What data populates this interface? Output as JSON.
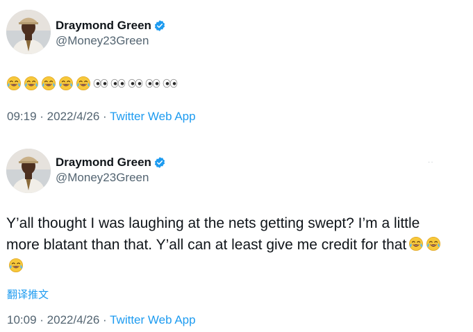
{
  "tweets": [
    {
      "author": {
        "name": "Draymond Green",
        "handle": "@Money23Green",
        "verified": true
      },
      "content": {
        "emojis": [
          "😂",
          "😂",
          "😂",
          "😂",
          "😂",
          "👀",
          "👀",
          "👀",
          "👀",
          "👀"
        ]
      },
      "meta": {
        "time": "09:19",
        "date": "2022/4/26",
        "separator": " · ",
        "app": "Twitter Web App"
      }
    },
    {
      "author": {
        "name": "Draymond Green",
        "handle": "@Money23Green",
        "verified": true
      },
      "content": {
        "text": "Y’all thought I was laughing at the nets getting swept? I’m a little more blatant than that. Y’all can at least give me credit for that",
        "trailing_emojis": [
          "😂",
          "😂",
          "😂"
        ]
      },
      "translate_label": "翻译推文",
      "more_label": "··",
      "meta": {
        "time": "10:09",
        "date": "2022/4/26",
        "separator": " · ",
        "app": "Twitter Web App"
      }
    }
  ],
  "colors": {
    "link": "#1d9bf0",
    "secondary": "#536471",
    "text": "#0f1419",
    "verified": "#1d9bf0"
  },
  "icons": {
    "verified": "verified-badge-icon",
    "laugh": "face-with-tears-of-joy-icon",
    "eyes": "eyes-icon"
  }
}
